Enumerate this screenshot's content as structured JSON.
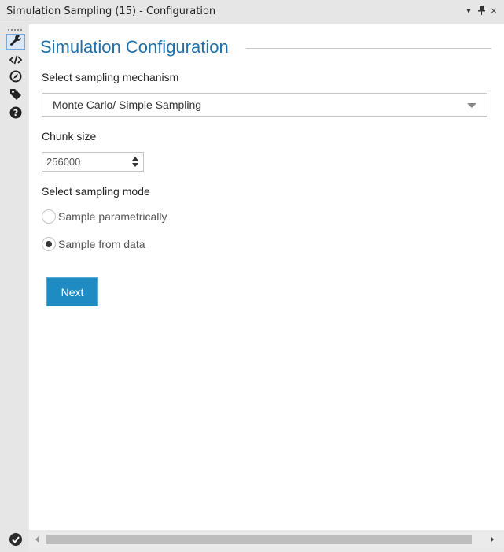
{
  "window": {
    "title": "Simulation Sampling (15) - Configuration",
    "controls": {
      "dropdown_icon": "dropdown-arrow-icon",
      "pin_icon": "pin-icon",
      "close_label": "×"
    }
  },
  "sidebar": {
    "items": [
      {
        "icon": "wrench-icon",
        "active": true
      },
      {
        "icon": "code-icon",
        "active": false
      },
      {
        "icon": "compass-icon",
        "active": false
      },
      {
        "icon": "tag-icon",
        "active": false
      },
      {
        "icon": "help-icon",
        "active": false
      }
    ]
  },
  "main": {
    "heading": "Simulation Configuration",
    "mechanism_label": "Select sampling mechanism",
    "mechanism_value": "Monte Carlo/ Simple Sampling",
    "chunk_label": "Chunk size",
    "chunk_value": "256000",
    "mode_label": "Select sampling mode",
    "modes": [
      {
        "label": "Sample parametrically",
        "checked": false
      },
      {
        "label": "Sample from data",
        "checked": true
      }
    ],
    "next_label": "Next"
  },
  "colors": {
    "heading": "#1f6fa8",
    "button": "#1e8bc3"
  }
}
